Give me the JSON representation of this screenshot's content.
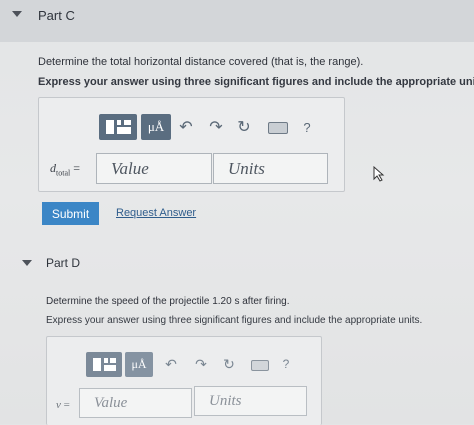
{
  "part_c": {
    "title": "Part C",
    "question": "Determine the total horizontal distance covered (that is, the range).",
    "instruction": "Express your answer using three significant figures and include the appropriate units.",
    "variable": "d",
    "variable_sub": "total",
    "equals": "=",
    "value_placeholder": "Value",
    "units_placeholder": "Units",
    "toolbar": {
      "units_label": "μÅ",
      "help_label": "?"
    },
    "submit_label": "Submit",
    "request_label": "Request Answer"
  },
  "part_d": {
    "title": "Part D",
    "question": "Determine the speed of the projectile 1.20 s after firing.",
    "instruction": "Express your answer using three significant figures and include the appropriate units.",
    "variable": "v",
    "equals": "=",
    "value_placeholder": "Value",
    "units_placeholder": "Units",
    "toolbar": {
      "units_label": "μÅ",
      "help_label": "?"
    }
  }
}
